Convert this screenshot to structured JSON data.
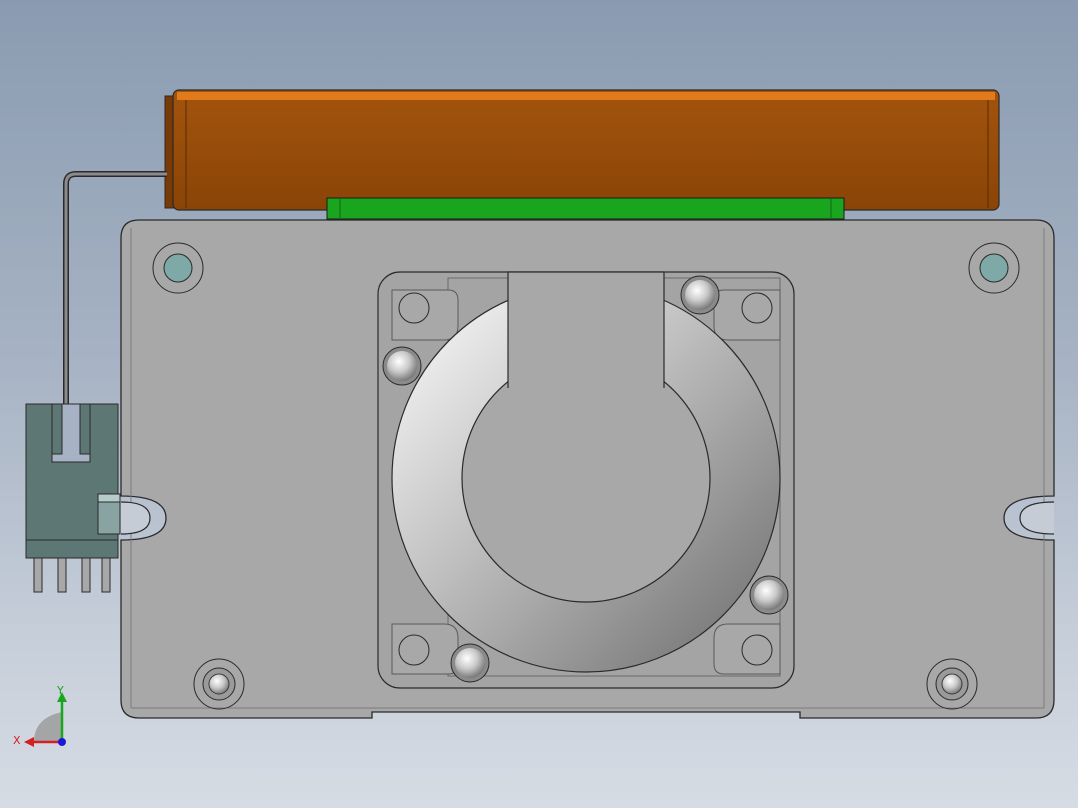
{
  "view": {
    "background_top": "#8a9bb1",
    "background_bottom": "#d6dce4"
  },
  "colors": {
    "motor_housing": "#944a08",
    "motor_edge": "#e07a1a",
    "pcb_strip": "#1aa51e",
    "base_plate": "#a8a8a8",
    "pin_hole": "#7fa9a7",
    "connector": "#5d7774"
  },
  "triad": {
    "x_label": "X",
    "y_label": "Y",
    "x_color": "#d42020",
    "y_color": "#1aa51e",
    "z_color": "#1a1ad4"
  }
}
